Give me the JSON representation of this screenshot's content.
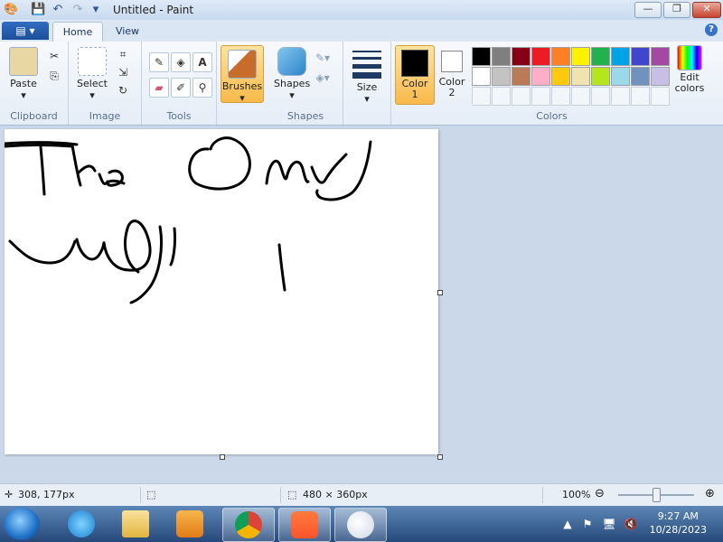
{
  "window": {
    "title": "Untitled - Paint"
  },
  "tabs": {
    "home": "Home",
    "view": "View"
  },
  "ribbon": {
    "clipboard": {
      "label": "Clipboard",
      "paste": "Paste"
    },
    "image": {
      "label": "Image",
      "select": "Select"
    },
    "tools": {
      "label": "Tools"
    },
    "brushes": {
      "label": "Brushes"
    },
    "shapes": {
      "label": "Shapes",
      "button": "Shapes"
    },
    "size": {
      "label": "Size"
    },
    "colors": {
      "label": "Colors",
      "color1": "Color 1",
      "color2": "Color 2",
      "edit": "Edit colors",
      "color1_value": "#000000",
      "color2_value": "#ffffff",
      "palette_row1": [
        "#000000",
        "#7f7f7f",
        "#880015",
        "#ed1c24",
        "#ff7f27",
        "#fff200",
        "#22b14c",
        "#00a2e8",
        "#3f48cc",
        "#a349a4"
      ],
      "palette_row2": [
        "#ffffff",
        "#c3c3c3",
        "#b97a57",
        "#ffaec9",
        "#ffc90e",
        "#efe4b0",
        "#b5e61d",
        "#99d9ea",
        "#7092be",
        "#c8bfe7"
      ]
    }
  },
  "status": {
    "cursor": "308, 177px",
    "size": "480 × 360px",
    "zoom": "100%"
  },
  "taskbar": {
    "time": "9:27 AM",
    "date": "10/28/2023"
  }
}
